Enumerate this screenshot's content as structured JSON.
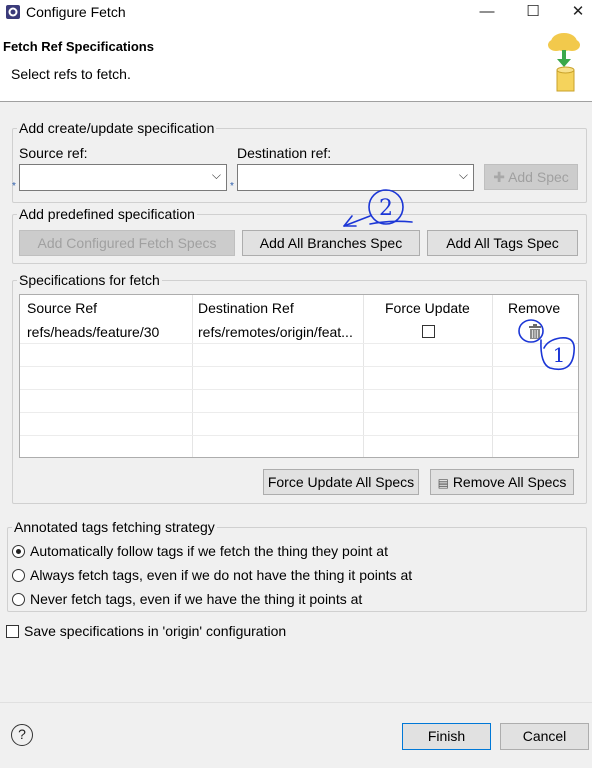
{
  "window": {
    "title": "Configure Fetch",
    "minimize_glyph": "—",
    "maximize_glyph": "☐",
    "close_glyph": "✕"
  },
  "header": {
    "title": "Fetch Ref Specifications",
    "description": "Select refs to fetch."
  },
  "create_group": {
    "label": "Add create/update specification",
    "source_label": "Source ref:",
    "dest_label": "Destination ref:",
    "source_value": "",
    "dest_value": "",
    "required_marker": "*",
    "add_spec_button": "Add Spec"
  },
  "predefined_group": {
    "label": "Add predefined specification",
    "add_configured_button": "Add Configured Fetch Specs",
    "add_branches_button": "Add All Branches Spec",
    "add_tags_button": "Add All Tags Spec"
  },
  "specs_group": {
    "label": "Specifications for fetch",
    "columns": [
      "Source Ref",
      "Destination Ref",
      "Force Update",
      "Remove"
    ],
    "rows": [
      {
        "source": "refs/heads/feature/30",
        "destination": "refs/remotes/origin/feat...",
        "force_update": false
      }
    ],
    "force_update_all_button": "Force Update All Specs",
    "remove_all_button": "Remove All Specs"
  },
  "tags_group": {
    "label": "Annotated tags fetching strategy",
    "options": [
      {
        "label": "Automatically follow tags if we fetch the thing they point at",
        "selected": true
      },
      {
        "label": "Always fetch tags, even if we do not have the thing it points at",
        "selected": false
      },
      {
        "label": "Never fetch tags, even if we have the thing it points at",
        "selected": false
      }
    ]
  },
  "save_option": {
    "label": "Save specifications in 'origin' configuration",
    "checked": false
  },
  "footer": {
    "help_glyph": "?",
    "finish_button": "Finish",
    "cancel_button": "Cancel"
  },
  "annotations": {
    "mark_1": "1",
    "mark_2": "2",
    "color": "#1b36d6"
  },
  "colors": {
    "default_button_border": "#0078d7",
    "folder_icon": "#f2c94c",
    "arrow_icon": "#3aa84a"
  }
}
